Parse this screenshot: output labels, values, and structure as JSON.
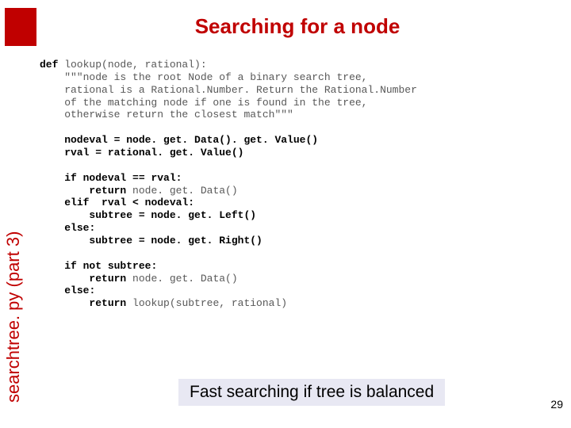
{
  "title": "Searching for a node",
  "side_label": "searchtree. py (part 3)",
  "caption": "Fast searching if tree is balanced",
  "page_number": "29",
  "code": {
    "l01a": "def",
    "l01b": " lookup(node, rational):",
    "l02": "    \"\"\"node is the root Node of a binary search tree,",
    "l03": "    rational is a Rational.Number. Return the Rational.Number",
    "l04": "    of the matching node if one is found in the tree,",
    "l05": "    otherwise return the closest match\"\"\"",
    "blank1": "",
    "l06": "    nodeval = node. get. Data(). get. Value()",
    "l07": "    rval = rational. get. Value()",
    "blank2": "",
    "l08a": "    ",
    "l08b": "if",
    "l08c": " nodeval == rval:",
    "l09a": "        ",
    "l09b": "return",
    "l09c": " node. get. Data()",
    "l10a": "    ",
    "l10b": "elif",
    "l10c": "  rval < nodeval:",
    "l11": "        subtree = node. get. Left()",
    "l12a": "    ",
    "l12b": "else",
    "l12c": ":",
    "l13": "        subtree = node. get. Right()",
    "blank3": "",
    "l14a": "    ",
    "l14b": "if not",
    "l14c": " subtree:",
    "l15a": "        ",
    "l15b": "return",
    "l15c": " node. get. Data()",
    "l16a": "    ",
    "l16b": "else",
    "l16c": ":",
    "l17a": "        ",
    "l17b": "return",
    "l17c": " lookup(subtree, rational)"
  }
}
